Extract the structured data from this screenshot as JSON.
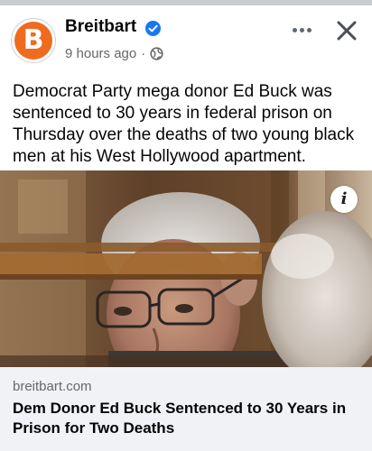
{
  "post": {
    "page_name": "Breitbart",
    "avatar_letter": "B",
    "timestamp": "9 hours ago",
    "separator": "·",
    "audience_icon": "globe-icon",
    "verified_icon": "verified-badge-icon",
    "text": "Democrat Party mega donor Ed Buck was sentenced to 30 years in federal prison on Thursday over the deaths of two young black men at his West Hollywood apartment."
  },
  "actions": {
    "more_icon": "more-options-icon",
    "close_icon": "close-icon"
  },
  "media": {
    "info_letter": "i",
    "info_icon": "info-icon"
  },
  "link_preview": {
    "domain": "breitbart.com",
    "title": "Dem Donor Ed Buck Sentenced to 30 Years in Prison for Two Deaths"
  },
  "colors": {
    "brand_orange": "#ef6b1f",
    "verified_blue": "#1877f2",
    "secondary_text": "#65676b",
    "card_background": "#f0f2f5"
  }
}
